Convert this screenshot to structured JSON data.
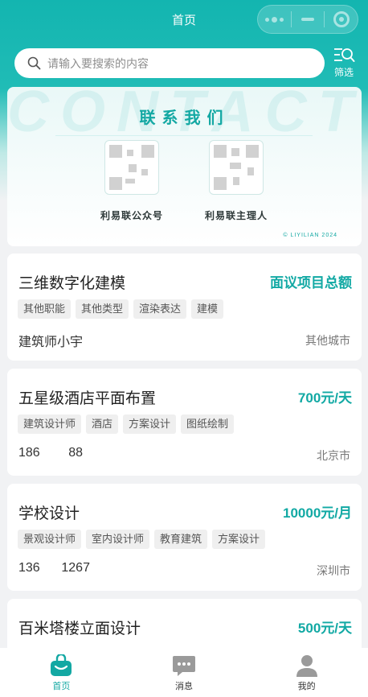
{
  "nav": {
    "title": "首页"
  },
  "search": {
    "placeholder": "请输入要搜索的内容"
  },
  "filter": {
    "label": "筛选"
  },
  "banner": {
    "bg_word": "CONTACT US",
    "title": "联系我们",
    "qr_left_label": "利易联公众号",
    "qr_right_label": "利易联主理人",
    "footer": "© LIYILIAN 2024"
  },
  "listings": [
    {
      "title": "三维数字化建模",
      "price": "面议项目总额",
      "tags": [
        "其他职能",
        "其他类型",
        "渲染表达",
        "建模"
      ],
      "poster": "建筑师小宇",
      "city": "其他城市"
    },
    {
      "title": "五星级酒店平面布置",
      "price": "700元/天",
      "tags": [
        "建筑设计师",
        "酒店",
        "方案设计",
        "图纸绘制"
      ],
      "poster": "186        88",
      "city": "北京市"
    },
    {
      "title": "学校设计",
      "price": "10000元/月",
      "tags": [
        "景观设计师",
        "室内设计师",
        "教育建筑",
        "方案设计"
      ],
      "poster": "136      1267",
      "city": "深圳市"
    },
    {
      "title": "百米塔楼立面设计",
      "price": "500元/天",
      "tags": [],
      "poster": "",
      "city": ""
    }
  ],
  "tabbar": [
    {
      "label": "首页",
      "icon": "home-bag-icon",
      "active": true
    },
    {
      "label": "消息",
      "icon": "message-icon",
      "active": false
    },
    {
      "label": "我的",
      "icon": "profile-icon",
      "active": false
    }
  ],
  "colors": {
    "accent": "#13b5b0",
    "price": "#12a9a4"
  }
}
